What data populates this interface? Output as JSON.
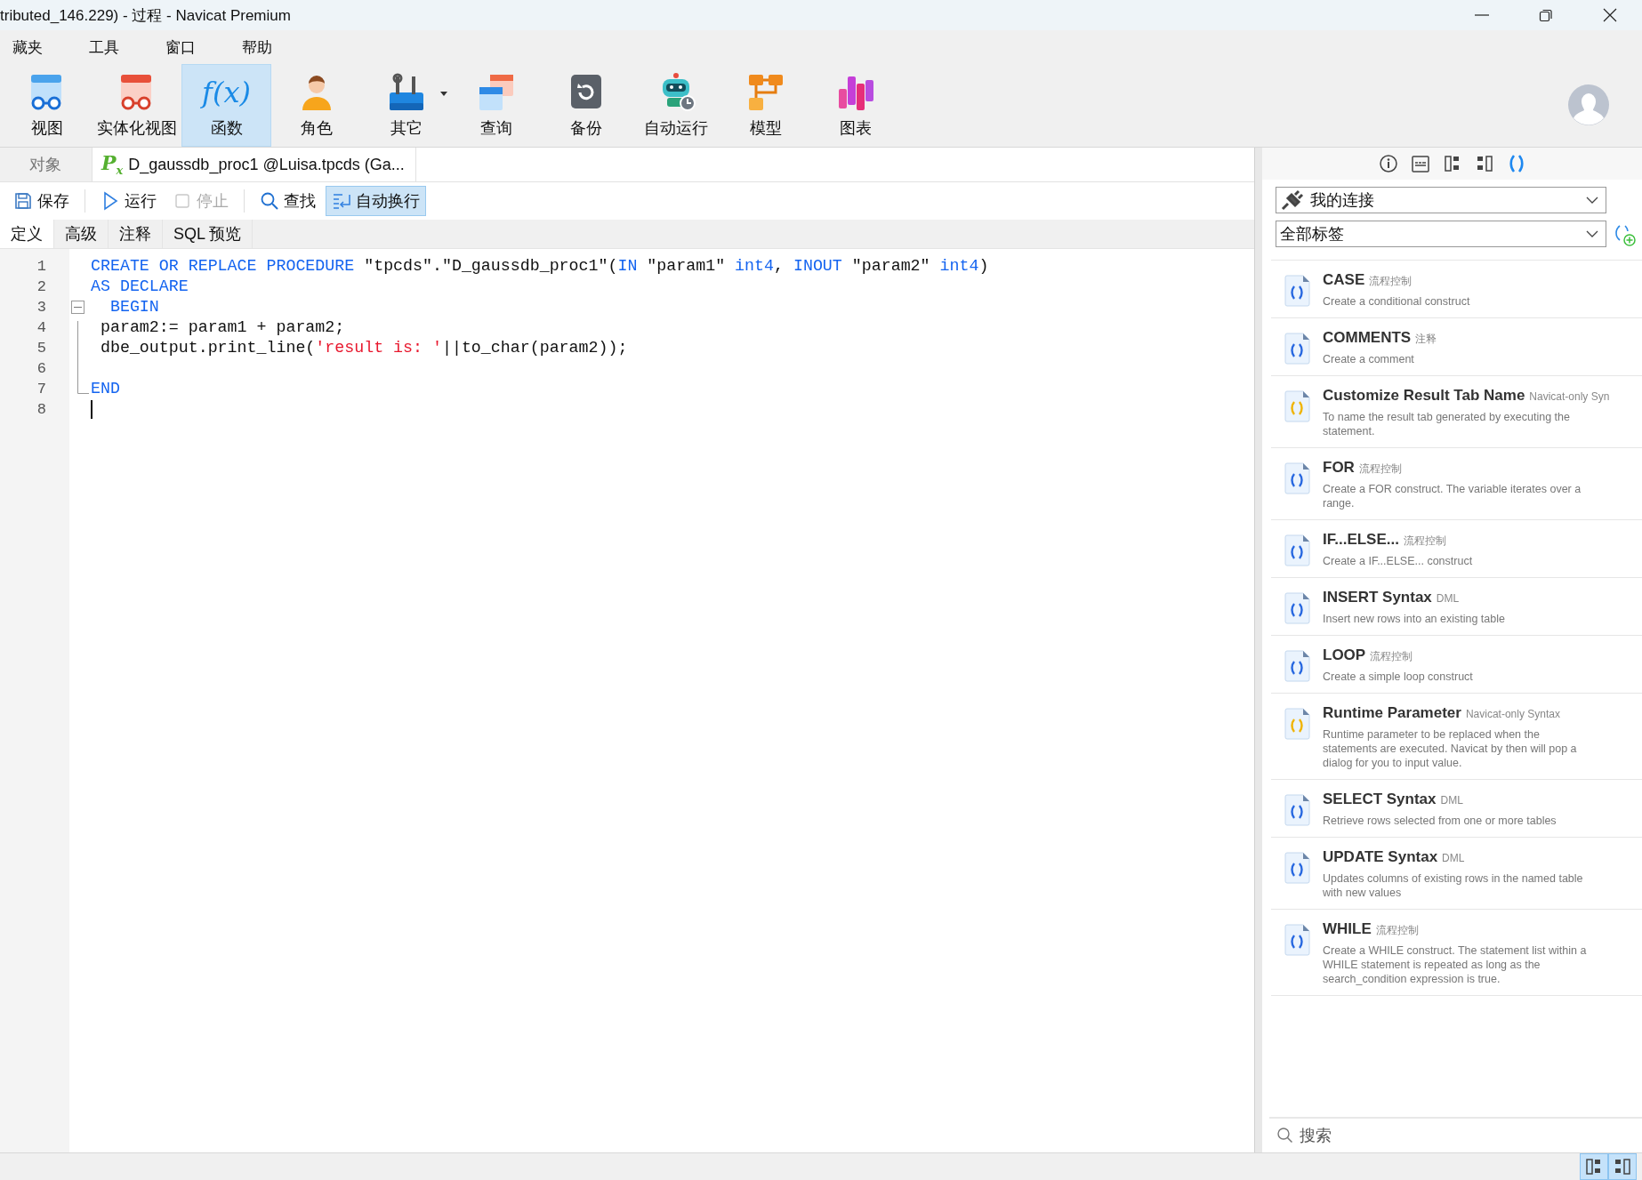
{
  "window": {
    "title": "tributed_146.229) - 过程 - Navicat Premium"
  },
  "menu": [
    "藏夹",
    "工具",
    "窗口",
    "帮助"
  ],
  "toolbar": [
    {
      "kind": "view",
      "label": "视图",
      "selected": false
    },
    {
      "kind": "matview",
      "label": "实体化视图",
      "selected": false
    },
    {
      "kind": "function",
      "label": "函数",
      "selected": true,
      "icon_text": "f(x)"
    },
    {
      "kind": "role",
      "label": "角色",
      "selected": false
    },
    {
      "kind": "other",
      "label": "其它",
      "selected": false,
      "dropdown": true
    },
    {
      "kind": "query",
      "label": "查询",
      "selected": false
    },
    {
      "kind": "backup",
      "label": "备份",
      "selected": false
    },
    {
      "kind": "automation",
      "label": "自动运行",
      "selected": false
    },
    {
      "kind": "model",
      "label": "模型",
      "selected": false
    },
    {
      "kind": "chart",
      "label": "图表",
      "selected": false
    }
  ],
  "object_tabs": [
    {
      "label": "对象",
      "selected": false
    },
    {
      "label": "D_gaussdb_proc1 @Luisa.tpcds (Ga...",
      "selected": true,
      "icon_text": "P$_{x}$"
    }
  ],
  "editor_toolbar": [
    {
      "kind": "save",
      "label": "保存",
      "disabled": false,
      "on": false
    },
    {
      "kind": "run",
      "label": "运行",
      "disabled": false,
      "on": false
    },
    {
      "kind": "stop",
      "label": "停止",
      "disabled": true,
      "on": false
    },
    {
      "kind": "find",
      "label": "查找",
      "disabled": false,
      "on": false
    },
    {
      "kind": "wrap",
      "label": "自动换行",
      "disabled": false,
      "on": true
    }
  ],
  "sub_tabs": [
    {
      "label": "定义",
      "selected": true
    },
    {
      "label": "高级",
      "selected": false
    },
    {
      "label": "注释",
      "selected": false
    },
    {
      "label": "SQL 预览",
      "selected": false
    }
  ],
  "code": [
    {
      "number": "1",
      "kind": "plain",
      "caret": false,
      "tokens": [
        {
          "kind": "keyword",
          "text": "CREATE OR REPLACE PROCEDURE"
        },
        {
          "kind": "plain",
          "text": " \"tpcds\".\"D_gaussdb_proc1\"("
        },
        {
          "kind": "keyword",
          "text": "IN"
        },
        {
          "kind": "plain",
          "text": " \"param1\" "
        },
        {
          "kind": "keyword",
          "text": "int4"
        },
        {
          "kind": "plain",
          "text": ", "
        },
        {
          "kind": "keyword",
          "text": "INOUT"
        },
        {
          "kind": "plain",
          "text": " \"param2\" "
        },
        {
          "kind": "keyword",
          "text": "int4"
        },
        {
          "kind": "plain",
          "text": ")"
        }
      ]
    },
    {
      "number": "2",
      "kind": "plain",
      "caret": false,
      "tokens": [
        {
          "kind": "keyword",
          "text": "AS DECLARE"
        }
      ]
    },
    {
      "number": "3",
      "kind": "fold-start",
      "caret": false,
      "tokens": [
        {
          "kind": "keyword",
          "text": "  BEGIN"
        }
      ]
    },
    {
      "number": "4",
      "kind": "fold-inside",
      "caret": false,
      "tokens": [
        {
          "kind": "plain",
          "text": " param2:= param1 + param2;"
        }
      ]
    },
    {
      "number": "5",
      "kind": "fold-inside",
      "caret": false,
      "tokens": [
        {
          "kind": "plain",
          "text": " dbe_output.print_line("
        },
        {
          "kind": "string",
          "text": "'result is: '"
        },
        {
          "kind": "plain",
          "text": "||to_char(param2));"
        }
      ]
    },
    {
      "number": "6",
      "kind": "fold-inside",
      "caret": false
    },
    {
      "number": "7",
      "kind": "fold-end",
      "caret": false,
      "tokens": [
        {
          "kind": "keyword",
          "text": "END"
        }
      ]
    },
    {
      "number": "8",
      "kind": "plain",
      "caret": true
    }
  ],
  "side_tools": [
    {
      "kind": "info",
      "selected": false
    },
    {
      "kind": "ddl",
      "selected": false
    },
    {
      "kind": "layout-left",
      "selected": false
    },
    {
      "kind": "layout-right",
      "selected": false
    },
    {
      "kind": "snippet",
      "selected": true
    }
  ],
  "connection_select": {
    "value": "我的连接"
  },
  "tag_select": {
    "value": "全部标签"
  },
  "snippets": [
    {
      "title": "CASE",
      "tag": "流程控制",
      "kind": "standard",
      "description": "Create a conditional construct"
    },
    {
      "title": "COMMENTS",
      "tag": "注释",
      "kind": "standard",
      "description": "Create a comment"
    },
    {
      "title": "Customize Result Tab Name",
      "tag": "Navicat-only Syn",
      "kind": "navicat",
      "description": "To name the result tab generated by executing the statement."
    },
    {
      "title": "FOR",
      "tag": "流程控制",
      "kind": "standard",
      "description": "Create a FOR construct. The variable iterates over a range."
    },
    {
      "title": "IF...ELSE...",
      "tag": "流程控制",
      "kind": "standard",
      "description": "Create a IF...ELSE... construct"
    },
    {
      "title": "INSERT Syntax",
      "tag": "DML",
      "kind": "standard",
      "description": "Insert new rows into an existing table"
    },
    {
      "title": "LOOP",
      "tag": "流程控制",
      "kind": "standard",
      "description": "Create a simple loop construct"
    },
    {
      "title": "Runtime Parameter",
      "tag": "Navicat-only Syntax",
      "kind": "navicat",
      "description": "Runtime parameter to be replaced when the statements are executed. Navicat by then will pop a dialog for you to input value."
    },
    {
      "title": "SELECT Syntax",
      "tag": "DML",
      "kind": "standard",
      "description": "Retrieve rows selected from one or more tables"
    },
    {
      "title": "UPDATE Syntax",
      "tag": "DML",
      "kind": "standard",
      "description": "Updates columns of existing rows in the named table with new values"
    },
    {
      "title": "WHILE",
      "tag": "流程控制",
      "kind": "standard",
      "description": "Create a WHILE construct. The statement list within a WHILE statement is repeated as long as the search_condition expression is true."
    }
  ],
  "snippet_search": {
    "placeholder": "搜索"
  },
  "status_bar": {
    "buttons": [
      {
        "kind": "layout-left",
        "selected": true
      },
      {
        "kind": "layout-right",
        "selected": true
      }
    ]
  }
}
